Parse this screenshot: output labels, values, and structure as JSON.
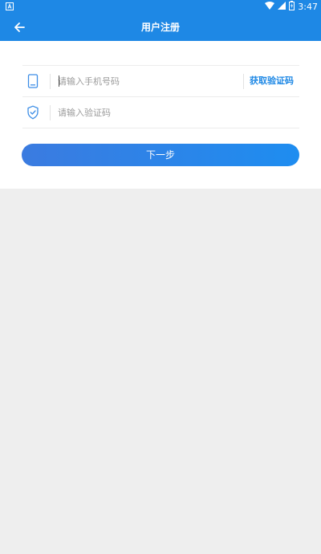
{
  "status_bar": {
    "time": "3:47",
    "icons": [
      "notification-a-icon",
      "wifi-icon",
      "signal-icon",
      "battery-icon"
    ]
  },
  "app_bar": {
    "title": "用户注册",
    "back_icon": "arrow-left-icon"
  },
  "form": {
    "phone": {
      "icon": "phone-icon",
      "value": "",
      "placeholder": "请输入手机号码"
    },
    "get_code_label": "获取验证码",
    "code": {
      "icon": "shield-check-icon",
      "value": "",
      "placeholder": "请输入验证码"
    },
    "next_label": "下一步"
  },
  "colors": {
    "primary": "#1e88e5",
    "background": "#eeeeee",
    "panel": "#ffffff",
    "placeholder": "#9b9b9b"
  }
}
